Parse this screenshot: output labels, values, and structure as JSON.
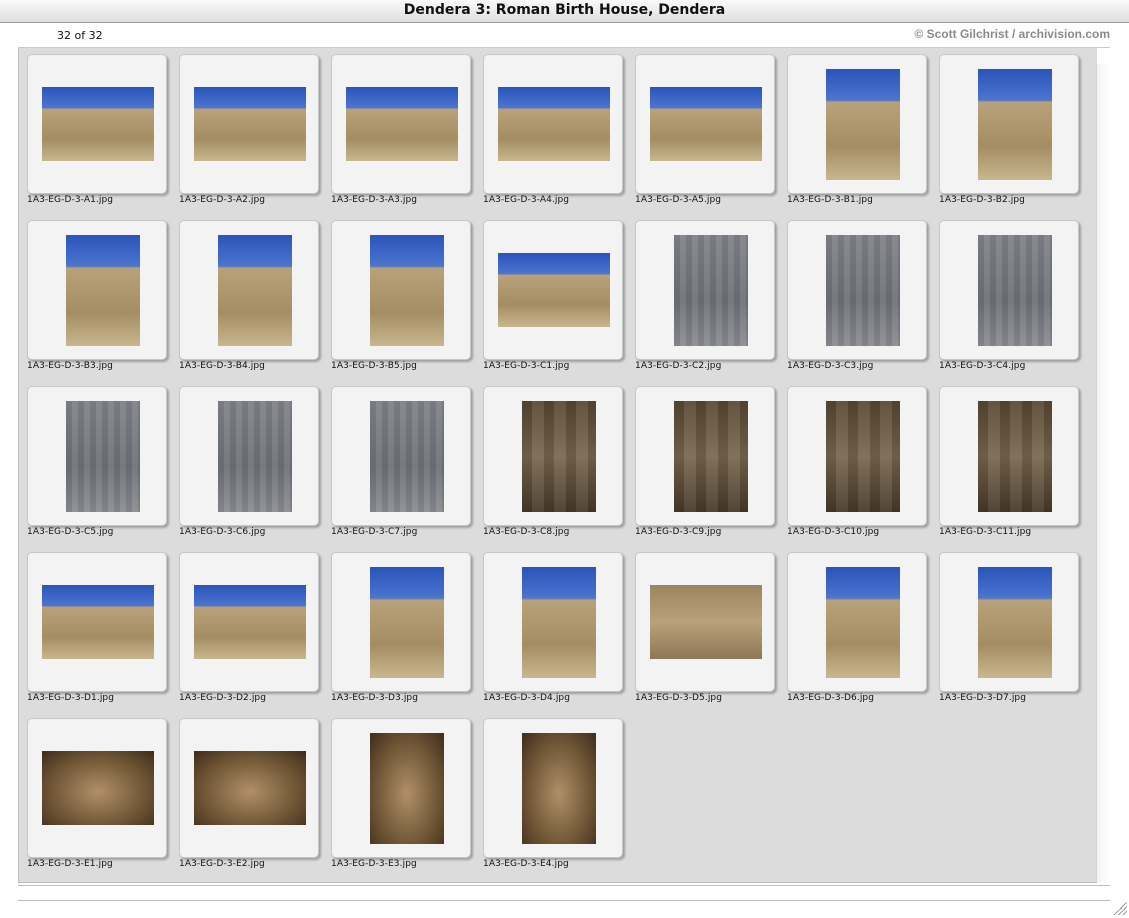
{
  "window": {
    "title": "Dendera 3: Roman Birth House, Dendera"
  },
  "header": {
    "count": "32 of 32",
    "credit": "© Scott Gilchrist / archivision.com"
  },
  "colors": {
    "sky": "#2a54b8",
    "stone": "#b8a27a",
    "relief": "#7f8289",
    "dark": "#5b4a36"
  },
  "thumbnails": [
    {
      "file": "1A3-EG-D-3-A1.jpg",
      "orientation": "landscape",
      "scene": "sky"
    },
    {
      "file": "1A3-EG-D-3-A2.jpg",
      "orientation": "landscape",
      "scene": "sky"
    },
    {
      "file": "1A3-EG-D-3-A3.jpg",
      "orientation": "landscape",
      "scene": "sky"
    },
    {
      "file": "1A3-EG-D-3-A4.jpg",
      "orientation": "landscape",
      "scene": "sky"
    },
    {
      "file": "1A3-EG-D-3-A5.jpg",
      "orientation": "landscape",
      "scene": "sky"
    },
    {
      "file": "1A3-EG-D-3-B1.jpg",
      "orientation": "portrait",
      "scene": "sky"
    },
    {
      "file": "1A3-EG-D-3-B2.jpg",
      "orientation": "portrait",
      "scene": "sky"
    },
    {
      "file": "1A3-EG-D-3-B3.jpg",
      "orientation": "portrait",
      "scene": "sky"
    },
    {
      "file": "1A3-EG-D-3-B4.jpg",
      "orientation": "portrait",
      "scene": "sky"
    },
    {
      "file": "1A3-EG-D-3-B5.jpg",
      "orientation": "portrait",
      "scene": "sky"
    },
    {
      "file": "1A3-EG-D-3-C1.jpg",
      "orientation": "landscape",
      "scene": "sky"
    },
    {
      "file": "1A3-EG-D-3-C2.jpg",
      "orientation": "portrait",
      "scene": "relief"
    },
    {
      "file": "1A3-EG-D-3-C3.jpg",
      "orientation": "portrait",
      "scene": "relief"
    },
    {
      "file": "1A3-EG-D-3-C4.jpg",
      "orientation": "portrait",
      "scene": "relief"
    },
    {
      "file": "1A3-EG-D-3-C5.jpg",
      "orientation": "portrait",
      "scene": "relief"
    },
    {
      "file": "1A3-EG-D-3-C6.jpg",
      "orientation": "portrait",
      "scene": "relief"
    },
    {
      "file": "1A3-EG-D-3-C7.jpg",
      "orientation": "portrait",
      "scene": "relief"
    },
    {
      "file": "1A3-EG-D-3-C8.jpg",
      "orientation": "portrait",
      "scene": "dark"
    },
    {
      "file": "1A3-EG-D-3-C9.jpg",
      "orientation": "portrait",
      "scene": "dark"
    },
    {
      "file": "1A3-EG-D-3-C10.jpg",
      "orientation": "portrait",
      "scene": "dark"
    },
    {
      "file": "1A3-EG-D-3-C11.jpg",
      "orientation": "portrait",
      "scene": "dark"
    },
    {
      "file": "1A3-EG-D-3-D1.jpg",
      "orientation": "landscape",
      "scene": "sky"
    },
    {
      "file": "1A3-EG-D-3-D2.jpg",
      "orientation": "landscape",
      "scene": "sky"
    },
    {
      "file": "1A3-EG-D-3-D3.jpg",
      "orientation": "portrait",
      "scene": "sky"
    },
    {
      "file": "1A3-EG-D-3-D4.jpg",
      "orientation": "portrait",
      "scene": "sky"
    },
    {
      "file": "1A3-EG-D-3-D5.jpg",
      "orientation": "landscape",
      "scene": "stone"
    },
    {
      "file": "1A3-EG-D-3-D6.jpg",
      "orientation": "portrait",
      "scene": "sky"
    },
    {
      "file": "1A3-EG-D-3-D7.jpg",
      "orientation": "portrait",
      "scene": "sky"
    },
    {
      "file": "1A3-EG-D-3-E1.jpg",
      "orientation": "landscape",
      "scene": "interior"
    },
    {
      "file": "1A3-EG-D-3-E2.jpg",
      "orientation": "landscape",
      "scene": "interior"
    },
    {
      "file": "1A3-EG-D-3-E3.jpg",
      "orientation": "portrait",
      "scene": "interior"
    },
    {
      "file": "1A3-EG-D-3-E4.jpg",
      "orientation": "portrait",
      "scene": "interior"
    }
  ]
}
